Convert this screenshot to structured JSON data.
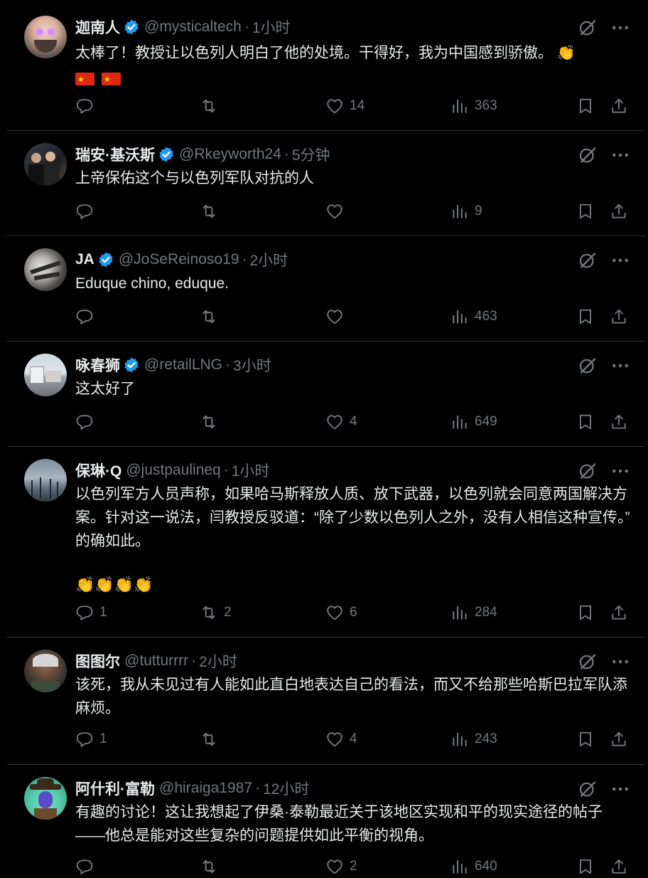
{
  "colors": {
    "background": "#000000",
    "text": "#e7e9ea",
    "muted": "#71767b",
    "divider": "#2f3336",
    "verified": "#1d9bf0"
  },
  "icons": {
    "reply": "reply-icon",
    "retweet": "retweet-icon",
    "like": "heart-icon",
    "views": "views-chart-icon",
    "bookmark": "bookmark-icon",
    "share": "share-icon",
    "grok": "grok-icon",
    "more": "more-icon",
    "verified": "verified-badge-icon"
  },
  "tweets": [
    {
      "name": "迦南人",
      "verified": true,
      "handle": "@mysticaltech",
      "time": "1小时",
      "text": "太棒了！教授让以色列人明白了他的处境。干得好，我为中国感到骄傲。 👏",
      "replies": "",
      "retweets": "",
      "likes": "14",
      "views": "363"
    },
    {
      "name": "瑞安·基沃斯",
      "verified": true,
      "handle": "@Rkeyworth24",
      "time": "5分钟",
      "text": "上帝保佑这个与以色列军队对抗的人",
      "replies": "",
      "retweets": "",
      "likes": "",
      "views": "9"
    },
    {
      "name": "JA",
      "verified": true,
      "handle": "@JoSeReinoso19",
      "time": "2小时",
      "text": "Eduque chino, eduque.",
      "replies": "",
      "retweets": "",
      "likes": "",
      "views": "463"
    },
    {
      "name": "咏春狮",
      "verified": true,
      "handle": "@retailLNG",
      "time": "3小时",
      "text": "这太好了",
      "replies": "",
      "retweets": "",
      "likes": "4",
      "views": "649"
    },
    {
      "name": "保琳·Q",
      "verified": false,
      "handle": "@justpaulineq",
      "time": "1小时",
      "text": "以色列军方人员声称，如果哈马斯释放人质、放下武器，以色列就会同意两国解决方案。针对这一说法，闫教授反驳道：“除了少数以色列人之外，没有人相信这种宣传。” 的确如此。",
      "text_extra": "👏👏👏👏",
      "replies": "1",
      "retweets": "2",
      "likes": "6",
      "views": "284"
    },
    {
      "name": "图图尔",
      "verified": false,
      "handle": "@tutturrrr",
      "time": "2小时",
      "text": "该死，我从未见过有人能如此直白地表达自己的看法，而又不给那些哈斯巴拉军队添麻烦。",
      "replies": "1",
      "retweets": "",
      "likes": "4",
      "views": "243"
    },
    {
      "name": "阿什利·富勒",
      "verified": false,
      "handle": "@hiraiga1987",
      "time": "12小时",
      "text": "有趣的讨论！这让我想起了伊桑·泰勒最近关于该地区实现和平的现实途径的帖子——他总是能对这些复杂的问题提供如此平衡的视角。",
      "replies": "",
      "retweets": "",
      "likes": "2",
      "views": "640"
    }
  ]
}
